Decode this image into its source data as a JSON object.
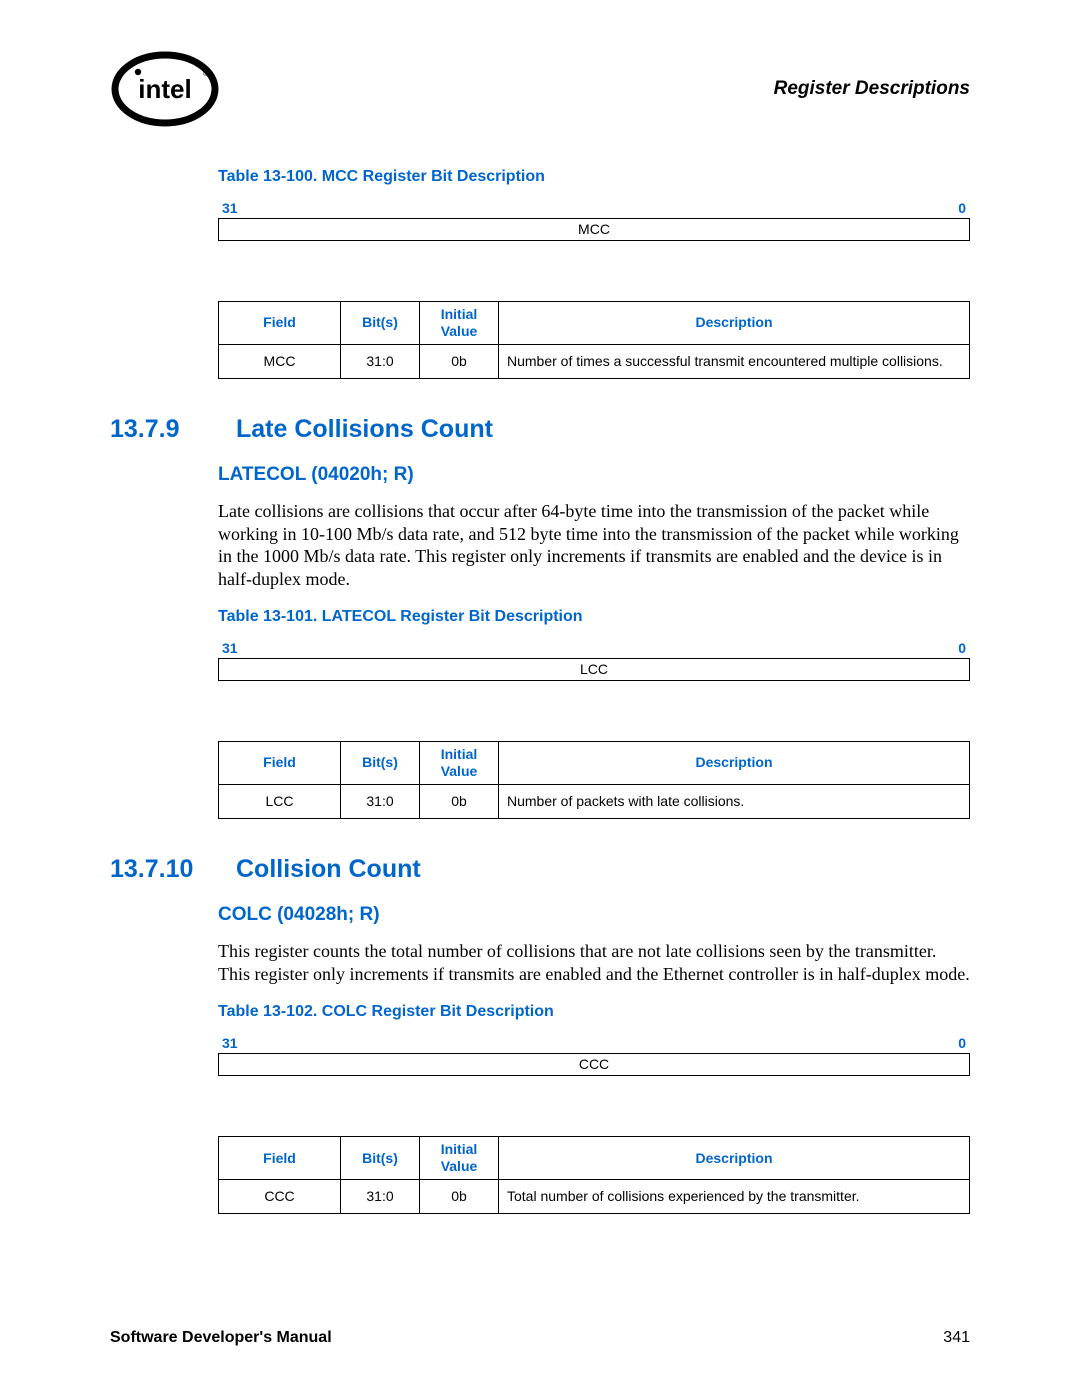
{
  "header": {
    "right": "Register Descriptions"
  },
  "tables": {
    "t100": {
      "caption": "Table 13-100. MCC Register Bit Description",
      "bit_hi": "31",
      "bit_lo": "0",
      "bit_name": "MCC",
      "headers": {
        "field": "Field",
        "bits": "Bit(s)",
        "init": "Initial Value",
        "desc": "Description"
      },
      "row": {
        "field": "MCC",
        "bits": "31:0",
        "init": "0b",
        "desc": "Number of times a successful transmit encountered multiple collisions."
      }
    },
    "t101": {
      "caption": "Table 13-101. LATECOL Register Bit Description",
      "bit_hi": "31",
      "bit_lo": "0",
      "bit_name": "LCC",
      "headers": {
        "field": "Field",
        "bits": "Bit(s)",
        "init": "Initial Value",
        "desc": "Description"
      },
      "row": {
        "field": "LCC",
        "bits": "31:0",
        "init": "0b",
        "desc": "Number of packets with late collisions."
      }
    },
    "t102": {
      "caption": "Table 13-102. COLC Register Bit Description",
      "bit_hi": "31",
      "bit_lo": "0",
      "bit_name": "CCC",
      "headers": {
        "field": "Field",
        "bits": "Bit(s)",
        "init": "Initial Value",
        "desc": "Description"
      },
      "row": {
        "field": "CCC",
        "bits": "31:0",
        "init": "0b",
        "desc": "Total number of collisions experienced by the transmitter."
      }
    }
  },
  "sec1": {
    "num": "13.7.9",
    "title": "Late Collisions Count",
    "sub": "LATECOL (04020h; R)",
    "body": "Late collisions are collisions that occur after 64-byte time into the transmission of the packet while working in 10-100 Mb/s data rate, and 512 byte time into the transmission of the packet while working in the 1000 Mb/s data rate. This register only increments if transmits are enabled and the device is in half-duplex mode."
  },
  "sec2": {
    "num": "13.7.10",
    "title": "Collision Count",
    "sub": "COLC (04028h; R)",
    "body": "This register counts the total number of collisions that are not late collisions seen by the transmitter. This register only increments if transmits are enabled and the Ethernet controller is in half-duplex mode."
  },
  "footer": {
    "left": "Software Developer's Manual",
    "right": "341"
  }
}
